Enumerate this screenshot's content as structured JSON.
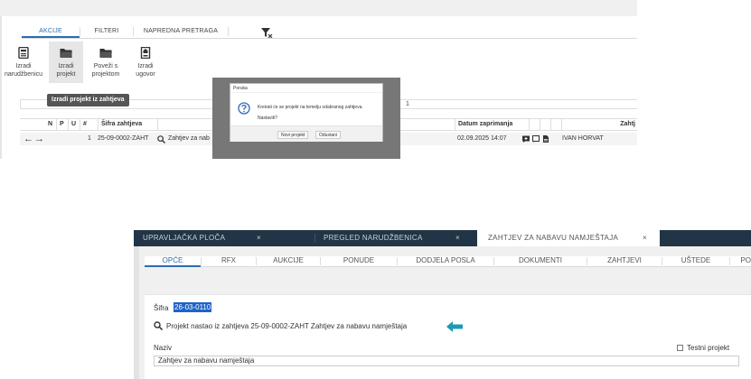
{
  "top": {
    "tabs": [
      {
        "label": "AKCIJE",
        "active": true
      },
      {
        "label": "FILTERI",
        "active": false
      },
      {
        "label": "NAPREDNA PRETRAGA",
        "active": false
      }
    ],
    "tools": [
      {
        "line1": "Izradi",
        "line2": "narudžbenicu",
        "icon": "document-icon"
      },
      {
        "line1": "Izradi",
        "line2": "projekt",
        "icon": "folder-icon"
      },
      {
        "line1": "Poveži s",
        "line2": "projektom",
        "icon": "folder-icon"
      },
      {
        "line1": "Izradi",
        "line2": "ugovor",
        "icon": "building-icon"
      }
    ],
    "tooltip": "Izradi projekt iz zahtjeva",
    "page_number": "1",
    "table": {
      "headers": [
        "N",
        "P",
        "U",
        "#",
        "Šifra zahtjeva",
        "Datum zaprimanja",
        "Zahtj"
      ],
      "row": {
        "num": "1",
        "sifra": "25-09-0002-ZAHT",
        "naziv": "Zahtjev za nab",
        "datum": "02.09.2025 14:07",
        "user": "IVAN HORVAT"
      }
    },
    "dialog": {
      "title": "Poruka",
      "line1": "Kreirati će se projekt na temelju odabranog zahtjeva.",
      "line2": "Nastaviti?",
      "ok_label": "Novi projekt",
      "cancel_label": "Odustani"
    }
  },
  "bottom": {
    "doc_tabs": [
      {
        "label": "UPRAVLJAČKA PLOČA",
        "active": false
      },
      {
        "label": "PREGLED NARUDŽBENICA",
        "active": false
      },
      {
        "label": "ZAHTJEV ZA NABAVU NAMJEŠTAJA",
        "active": true
      }
    ],
    "close_glyph": "×",
    "sub_tabs": [
      "OPĆE",
      "RFX",
      "AUKCIJE",
      "PONUDE",
      "DODJELA POSLA",
      "DOKUMENTI",
      "ZAHTJEVI",
      "UŠTEDE",
      "PO"
    ],
    "sifra_label": "Šifra",
    "sifra_value": "26-03-0110",
    "origin_text": "Projekt nastao iz zahtjeva 25-09-0002-ZAHT Zahtjev za nabavu namještaja",
    "naziv_label": "Naziv",
    "naziv_value": "Zahtjev za nabavu namještaja",
    "testni_label": "Testni projekt"
  },
  "colors": {
    "accent": "#2b6cb0",
    "navy": "#213547",
    "arrow": "#1a9bb5",
    "highlight": "#1e63c9"
  }
}
